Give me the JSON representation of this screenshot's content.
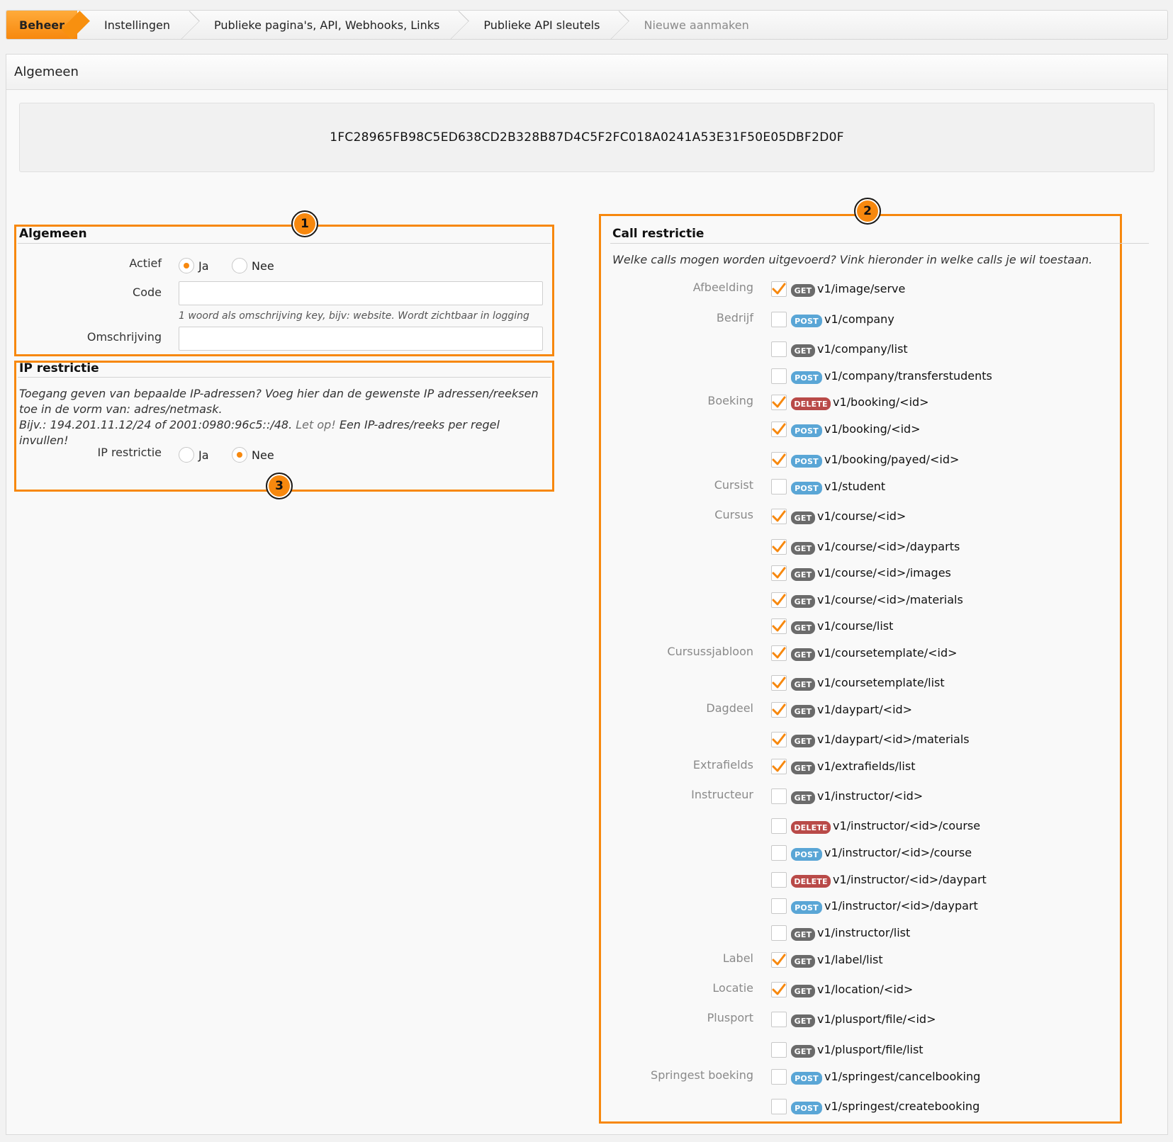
{
  "breadcrumb": [
    "Beheer",
    "Instellingen",
    "Publieke pagina's, API, Webhooks, Links",
    "Publieke API sleutels",
    "Nieuwe aanmaken"
  ],
  "panel_title": "Algemeen",
  "api_key": "1FC28965FB98C5ED638CD2B328B87D4C5F2FC018A0241A53E31F50E05DBF2D0F",
  "badges": [
    "1",
    "2",
    "3"
  ],
  "general": {
    "title": "Algemeen",
    "actief_label": "Actief",
    "option_yes": "Ja",
    "option_no": "Nee",
    "actief_selected": "Ja",
    "code_label": "Code",
    "code_value": "",
    "code_hint": "1 woord als omschrijving key, bijv: website. Wordt zichtbaar in logging",
    "omschrijving_label": "Omschrijving",
    "omschrijving_value": ""
  },
  "ip": {
    "title": "IP restrictie",
    "desc_line1": "Toegang geven van bepaalde IP-adressen? Voeg hier dan de gewenste IP adressen/reeksen toe in de vorm van: adres/netmask.",
    "desc_line2_a": "Bijv.: 194.201.11.12/24 of 2001:0980:96c5::/48.",
    "desc_line2_warn": "Let op!",
    "desc_line2_b": "Een IP-adres/reeks per regel invullen!",
    "label": "IP restrictie",
    "option_yes": "Ja",
    "option_no": "Nee",
    "selected": "Nee"
  },
  "calls": {
    "title": "Call restrictie",
    "intro": "Welke calls mogen worden uitgevoerd? Vink hieronder in welke calls je wil toestaan.",
    "colors": {
      "GET": "#6b6b6b",
      "POST": "#5aa6d6",
      "DELETE": "#b94a48",
      "check": "#f7880e"
    },
    "rows": [
      {
        "group": "Afbeelding",
        "method": "GET",
        "path": "v1/image/serve",
        "checked": true
      },
      {
        "group": "Bedrijf",
        "method": "POST",
        "path": "v1/company",
        "checked": false
      },
      {
        "group": "",
        "method": "GET",
        "path": "v1/company/list",
        "checked": false
      },
      {
        "group": "",
        "method": "POST",
        "path": "v1/company/transferstudents",
        "checked": false
      },
      {
        "group": "Boeking",
        "method": "DELETE",
        "path": "v1/booking/<id>",
        "checked": true
      },
      {
        "group": "",
        "method": "POST",
        "path": "v1/booking/<id>",
        "checked": true
      },
      {
        "group": "",
        "method": "POST",
        "path": "v1/booking/payed/<id>",
        "checked": true
      },
      {
        "group": "Cursist",
        "method": "POST",
        "path": "v1/student",
        "checked": false
      },
      {
        "group": "Cursus",
        "method": "GET",
        "path": "v1/course/<id>",
        "checked": true
      },
      {
        "group": "",
        "method": "GET",
        "path": "v1/course/<id>/dayparts",
        "checked": true
      },
      {
        "group": "",
        "method": "GET",
        "path": "v1/course/<id>/images",
        "checked": true
      },
      {
        "group": "",
        "method": "GET",
        "path": "v1/course/<id>/materials",
        "checked": true
      },
      {
        "group": "",
        "method": "GET",
        "path": "v1/course/list",
        "checked": true
      },
      {
        "group": "Cursussjabloon",
        "method": "GET",
        "path": "v1/coursetemplate/<id>",
        "checked": true
      },
      {
        "group": "",
        "method": "GET",
        "path": "v1/coursetemplate/list",
        "checked": true
      },
      {
        "group": "Dagdeel",
        "method": "GET",
        "path": "v1/daypart/<id>",
        "checked": true
      },
      {
        "group": "",
        "method": "GET",
        "path": "v1/daypart/<id>/materials",
        "checked": true
      },
      {
        "group": "Extrafields",
        "method": "GET",
        "path": "v1/extrafields/list",
        "checked": true
      },
      {
        "group": "Instructeur",
        "method": "GET",
        "path": "v1/instructor/<id>",
        "checked": false
      },
      {
        "group": "",
        "method": "DELETE",
        "path": "v1/instructor/<id>/course",
        "checked": false
      },
      {
        "group": "",
        "method": "POST",
        "path": "v1/instructor/<id>/course",
        "checked": false
      },
      {
        "group": "",
        "method": "DELETE",
        "path": "v1/instructor/<id>/daypart",
        "checked": false
      },
      {
        "group": "",
        "method": "POST",
        "path": "v1/instructor/<id>/daypart",
        "checked": false
      },
      {
        "group": "",
        "method": "GET",
        "path": "v1/instructor/list",
        "checked": false
      },
      {
        "group": "Label",
        "method": "GET",
        "path": "v1/label/list",
        "checked": true
      },
      {
        "group": "Locatie",
        "method": "GET",
        "path": "v1/location/<id>",
        "checked": true
      },
      {
        "group": "Plusport",
        "method": "GET",
        "path": "v1/plusport/file/<id>",
        "checked": false
      },
      {
        "group": "",
        "method": "GET",
        "path": "v1/plusport/file/list",
        "checked": false
      },
      {
        "group": "Springest boeking",
        "method": "POST",
        "path": "v1/springest/cancelbooking",
        "checked": false
      },
      {
        "group": "",
        "method": "POST",
        "path": "v1/springest/createbooking",
        "checked": false
      }
    ]
  }
}
